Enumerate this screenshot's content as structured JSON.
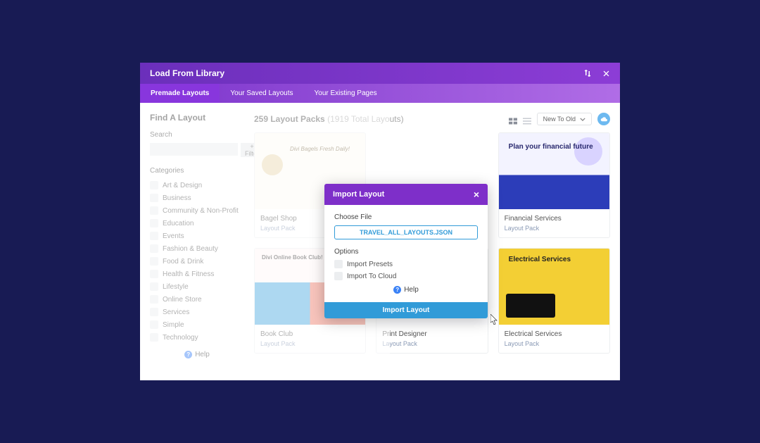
{
  "header": {
    "title": "Load From Library"
  },
  "tabs": [
    {
      "label": "Premade Layouts",
      "active": true
    },
    {
      "label": "Your Saved Layouts",
      "active": false
    },
    {
      "label": "Your Existing Pages",
      "active": false
    }
  ],
  "sidebar": {
    "title": "Find A Layout",
    "search_label": "Search",
    "search_placeholder": "",
    "filter_label": "+ Filter",
    "categories_label": "Categories",
    "categories": [
      "Art & Design",
      "Business",
      "Community & Non-Profit",
      "Education",
      "Events",
      "Fashion & Beauty",
      "Food & Drink",
      "Health & Fitness",
      "Lifestyle",
      "Online Store",
      "Services",
      "Simple",
      "Technology"
    ],
    "help_label": "Help"
  },
  "main": {
    "count_text": "259 Layout Packs",
    "count_sub": "(1919 Total Layouts)",
    "sort_label": "New To Old"
  },
  "cards": [
    {
      "title": "Bagel Shop",
      "sub": "Layout Pack",
      "thumb": "bagel",
      "thumb_text": "Divi Bagels\nFresh Daily!"
    },
    {
      "title": "",
      "sub": "",
      "thumb": "hidden"
    },
    {
      "title": "Financial Services",
      "sub": "Layout Pack",
      "thumb": "fin",
      "thumb_text": "Plan your\nfinancial future"
    },
    {
      "title": "Book Club",
      "sub": "Layout Pack",
      "thumb": "book",
      "thumb_text": "Divi Online Book\nClub!"
    },
    {
      "title": "Print Designer",
      "sub": "Layout Pack",
      "thumb": "print",
      "thumb_text": ""
    },
    {
      "title": "Electrical Services",
      "sub": "Layout Pack",
      "thumb": "elec",
      "thumb_text": "Electrical\nServices"
    }
  ],
  "modal": {
    "title": "Import Layout",
    "choose_label": "Choose File",
    "file_name": "TRAVEL_ALL_LAYOUTS.JSON",
    "options_label": "Options",
    "opt_presets": "Import Presets",
    "opt_cloud": "Import To Cloud",
    "help_label": "Help",
    "submit_label": "Import Layout"
  }
}
